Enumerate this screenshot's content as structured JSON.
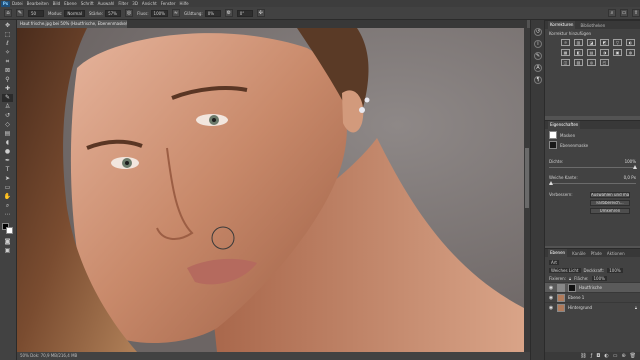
{
  "menubar": {
    "logo": "Ps",
    "items": [
      "Datei",
      "Bearbeiten",
      "Bild",
      "Ebene",
      "Schrift",
      "Auswahl",
      "Filter",
      "3D",
      "Ansicht",
      "Fenster",
      "Hilfe"
    ]
  },
  "options": {
    "size_label": "50",
    "mode_label": "Modus:",
    "mode_value": "Normal",
    "strength_label": "Stärke:",
    "strength_value": "57%",
    "flow_label": "Fluss:",
    "flow_value": "100%",
    "smooth_label": "Glättung:",
    "smooth_value": "0%",
    "angle_value": "0°"
  },
  "document": {
    "tab_title": "Haut frische.jpg bei 50% (Hautfrische, Ebenenmaske/8) *",
    "status": "50%   Dok: 70,9 MB/216,4 MB"
  },
  "panels": {
    "adjust_tabs": [
      "Korrekturen",
      "Bibliotheken"
    ],
    "adjust_heading": "Korrektur hinzufügen",
    "adjust_icons": [
      "☼",
      "▥",
      "◪",
      "◩",
      "▽",
      "◐",
      "▦",
      "◧",
      "▤",
      "◑",
      "▣",
      "◍",
      "◫",
      "▧",
      "◎",
      "◰"
    ],
    "props_tabs": [
      "Eigenschaften"
    ],
    "props_masks": "Masken",
    "props_layer_mask": "Ebenenmaske",
    "density_label": "Dichte:",
    "density_value": "100%",
    "feather_label": "Weiche Kante:",
    "feather_value": "0,0 Px",
    "refine_label": "Verbessern:",
    "btn_select_mask": "Auswählen und maskieren...",
    "btn_color_range": "Farbbereich...",
    "btn_invert": "Umkehren",
    "layers_tabs": [
      "Ebenen",
      "Kanäle",
      "Pfade",
      "Aktionen"
    ],
    "layers_kind": "Art",
    "blend_mode": "Weiches Licht",
    "opacity_label": "Deckkraft:",
    "opacity_value": "100%",
    "lock_label": "Fixieren:",
    "fill_label": "Fläche:",
    "fill_value": "100%",
    "layers": [
      {
        "name": "Hautfrische",
        "selected": true
      },
      {
        "name": "Ebene 1",
        "selected": false
      },
      {
        "name": "Hintergrund",
        "selected": false
      }
    ]
  }
}
